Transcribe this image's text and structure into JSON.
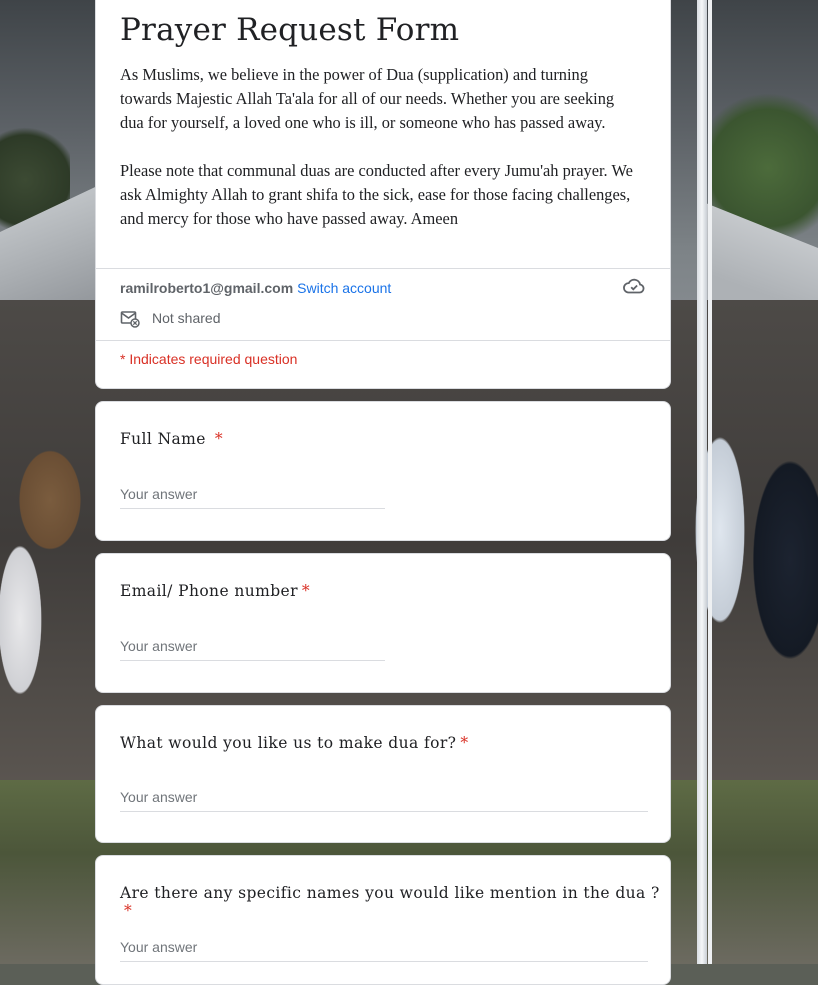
{
  "form": {
    "title": "Prayer Request Form",
    "description": [
      "As Muslims, we believe in the power of Dua (supplication) and turning towards Majestic Allah Ta'ala for all of our needs. Whether you are seeking dua for yourself, a loved one who is ill, or someone who has passed away.",
      "Please note that communal duas are conducted after every Jumu'ah prayer. We ask Almighty Allah to grant shifa to the sick, ease for those facing challenges, and mercy for those who have passed away. Ameen"
    ],
    "account_email": "ramilroberto1@gmail.com",
    "switch_account_label": "Switch account",
    "sharing_status": "Not shared",
    "required_note": "* Indicates required question",
    "icons": {
      "cloud": "cloud-done-icon",
      "mail": "mail-not-shared-icon"
    },
    "accent_color": "#1a73e8",
    "required_color": "#d93025"
  },
  "questions": [
    {
      "title": "Full Name",
      "required_mark": "*",
      "placeholder": "Your answer"
    },
    {
      "title": "Email/ Phone number",
      "required_mark": "*",
      "placeholder": "Your answer"
    },
    {
      "title": "What would you like us to make dua for?",
      "required_mark": "*",
      "placeholder": "Your answer"
    },
    {
      "title": "Are there any specific names you would like mention in the dua ?",
      "required_mark": "*",
      "placeholder": "Your answer"
    }
  ]
}
